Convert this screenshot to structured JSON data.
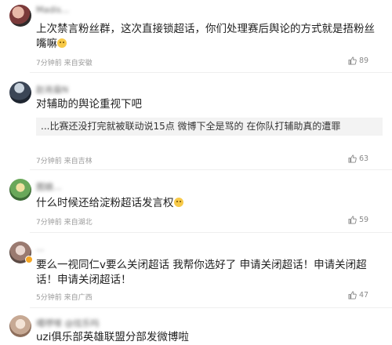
{
  "comments": [
    {
      "username": "Madis...",
      "text": "上次禁言粉丝群，这次直接锁超话，你们处理赛后舆论的方式就是捂粉丝嘴嘛",
      "time": "7分钟前",
      "location": "来自安徽",
      "likes": "89"
    },
    {
      "username": "赵肖燊N",
      "text": "对辅助的舆论重视下吧",
      "quote": "...比赛还没打完就被联动说15点 微博下全是骂的 在你队打辅助真的遭罪",
      "time": "7分钟前",
      "location": "来自吉林",
      "likes": "63"
    },
    {
      "username": "图娘...",
      "text": "什么时候还给淀粉超话发言权",
      "time": "7分钟前",
      "location": "来自湖北",
      "likes": "59"
    },
    {
      "username": "...",
      "text": "要么一视同仁v要么关闭超话 我帮你选好了 申请关闭超话！申请关闭超话！申请关闭超话！",
      "time": "5分钟前",
      "location": "来自广西",
      "likes": "47"
    },
    {
      "username": "噶啰嗦 @炫乐吗",
      "text": "uzi俱乐部英雄联盟分部发微博啦",
      "time": "",
      "location": "",
      "likes": ""
    }
  ],
  "icons": {
    "like": "thumbs-up-icon"
  },
  "colors": {
    "emoji": "#f7c948",
    "badge": "#f5a623"
  }
}
